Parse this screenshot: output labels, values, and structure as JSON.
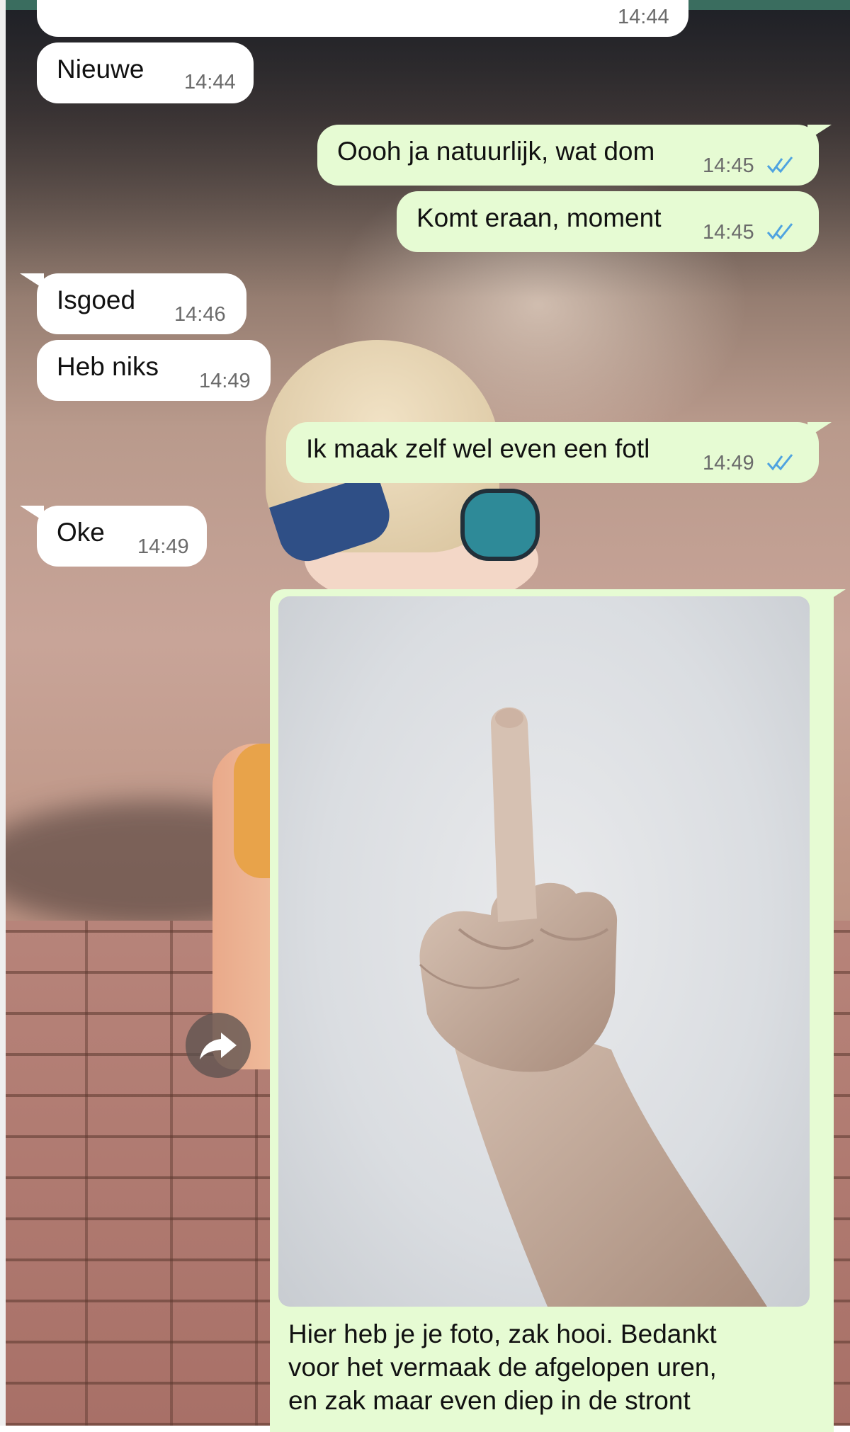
{
  "chat": {
    "partial_top_time": "14:44",
    "messages": [
      {
        "text": "Nieuwe",
        "time": "14:44",
        "direction": "in"
      },
      {
        "text": "Oooh ja natuurlijk, wat dom",
        "time": "14:45",
        "direction": "out",
        "status": "read"
      },
      {
        "text": "Komt eraan, moment",
        "time": "14:45",
        "direction": "out",
        "status": "read"
      },
      {
        "text": "Isgoed",
        "time": "14:46",
        "direction": "in"
      },
      {
        "text": "Heb niks",
        "time": "14:49",
        "direction": "in"
      },
      {
        "text": "Ik maak zelf wel even een fotl",
        "time": "14:49",
        "direction": "out",
        "status": "read"
      },
      {
        "text": "Oke",
        "time": "14:49",
        "direction": "in"
      }
    ],
    "photo_message": {
      "caption": "Hier heb je je foto, zak hooi. Bedankt\nvoor het vermaak de afgelopen uren,\nen zak maar even diep in de stront",
      "direction": "out"
    }
  },
  "icons": {
    "forward": "forward-icon",
    "read_receipt": "double-check-icon"
  },
  "colors": {
    "incoming_bubble": "#ffffff",
    "outgoing_bubble": "#e6fbd3",
    "read_tick": "#4fa3e0",
    "timestamp": "#6b6b6b"
  }
}
